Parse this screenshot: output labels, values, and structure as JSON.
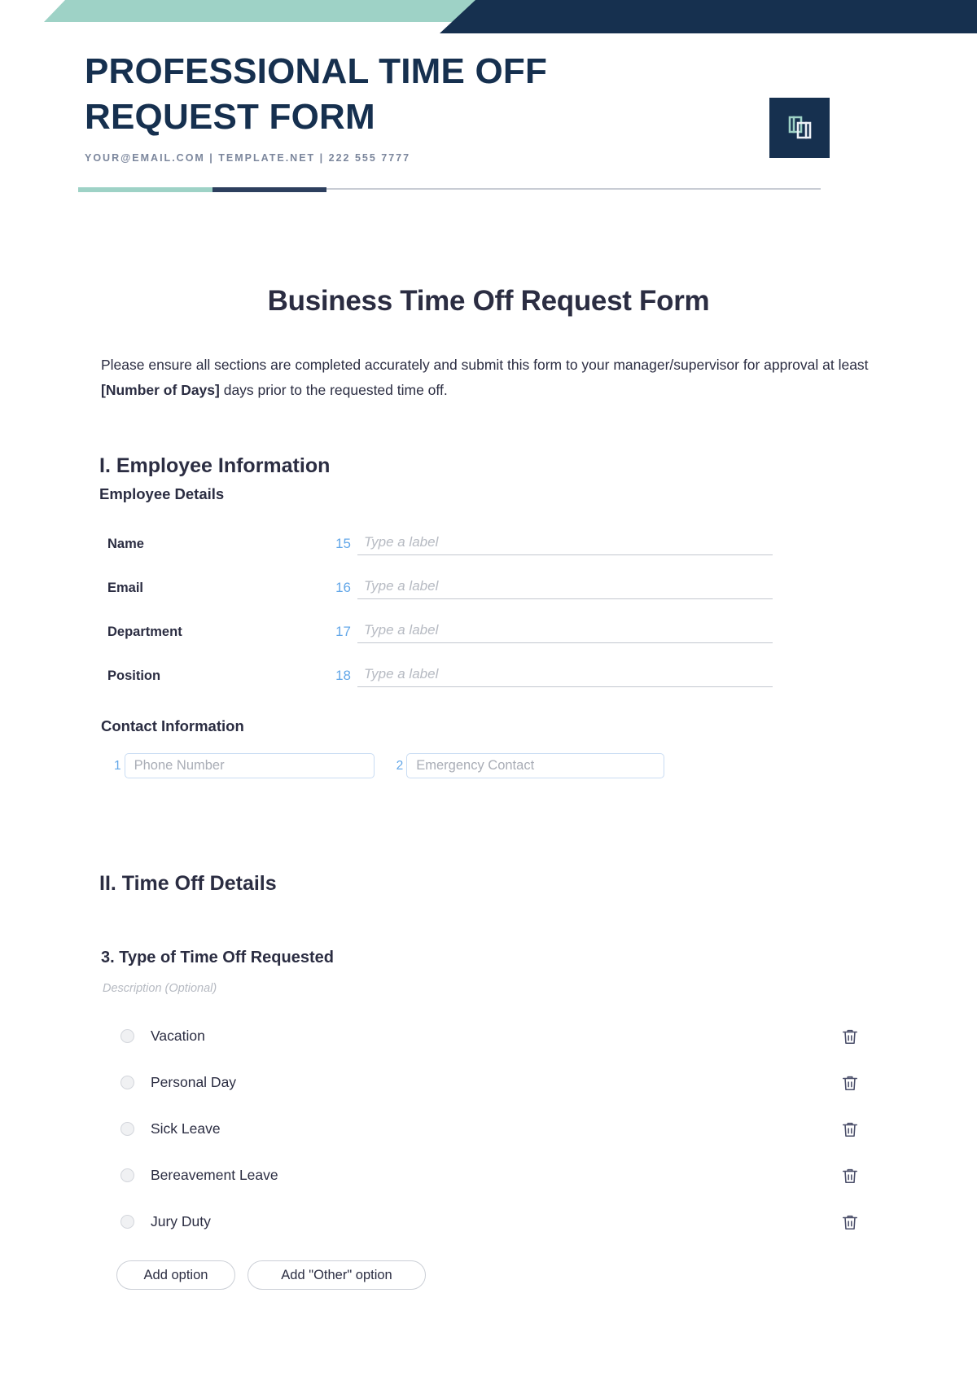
{
  "letterhead": {
    "title": "PROFESSIONAL TIME OFF REQUEST FORM",
    "contact": "YOUR@EMAIL.COM | TEMPLATE.NET | 222 555 7777",
    "logo_icon": "overlapping-brackets-logo-icon",
    "colors": {
      "navy": "#16304f",
      "mint": "#9ed2c6",
      "divider_navy": "#2d3f5e",
      "divider_gray": "#c8ccd4",
      "contact_text": "#7b869c"
    }
  },
  "document": {
    "title": "Business Time Off Request Form",
    "intro": {
      "before": "Please ensure all sections are completed accurately and submit this form to your manager/supervisor for approval at least ",
      "bold": "[Number of Days]",
      "after": " days prior to the requested time off."
    }
  },
  "section_one": {
    "heading": "I. Employee Information",
    "subheading": "Employee Details",
    "fields": [
      {
        "label": "Name",
        "number": "15",
        "placeholder": "Type a label"
      },
      {
        "label": "Email",
        "number": "16",
        "placeholder": "Type a label"
      },
      {
        "label": "Department",
        "number": "17",
        "placeholder": "Type a label"
      },
      {
        "label": "Position",
        "number": "18",
        "placeholder": "Type a label"
      }
    ],
    "contact_heading": "Contact Information",
    "contact_fields": [
      {
        "number": "1",
        "placeholder": "Phone Number"
      },
      {
        "number": "2",
        "placeholder": "Emergency Contact"
      }
    ]
  },
  "section_two": {
    "heading": "II. Time Off Details",
    "question": {
      "title": "3. Type of Time Off Requested",
      "description": "Description (Optional)",
      "options": [
        {
          "label": "Vacation",
          "delete_icon": "trash-icon"
        },
        {
          "label": "Personal Day",
          "delete_icon": "trash-icon"
        },
        {
          "label": "Sick Leave",
          "delete_icon": "trash-icon"
        },
        {
          "label": "Bereavement Leave",
          "delete_icon": "trash-icon"
        },
        {
          "label": "Jury Duty",
          "delete_icon": "trash-icon"
        }
      ],
      "add_option_label": "Add option",
      "add_other_option_label": "Add \"Other\" option"
    }
  },
  "colors": {
    "accent_blue": "#63a7e8",
    "text_dark": "#2b2d42",
    "placeholder": "#b6bac2"
  }
}
